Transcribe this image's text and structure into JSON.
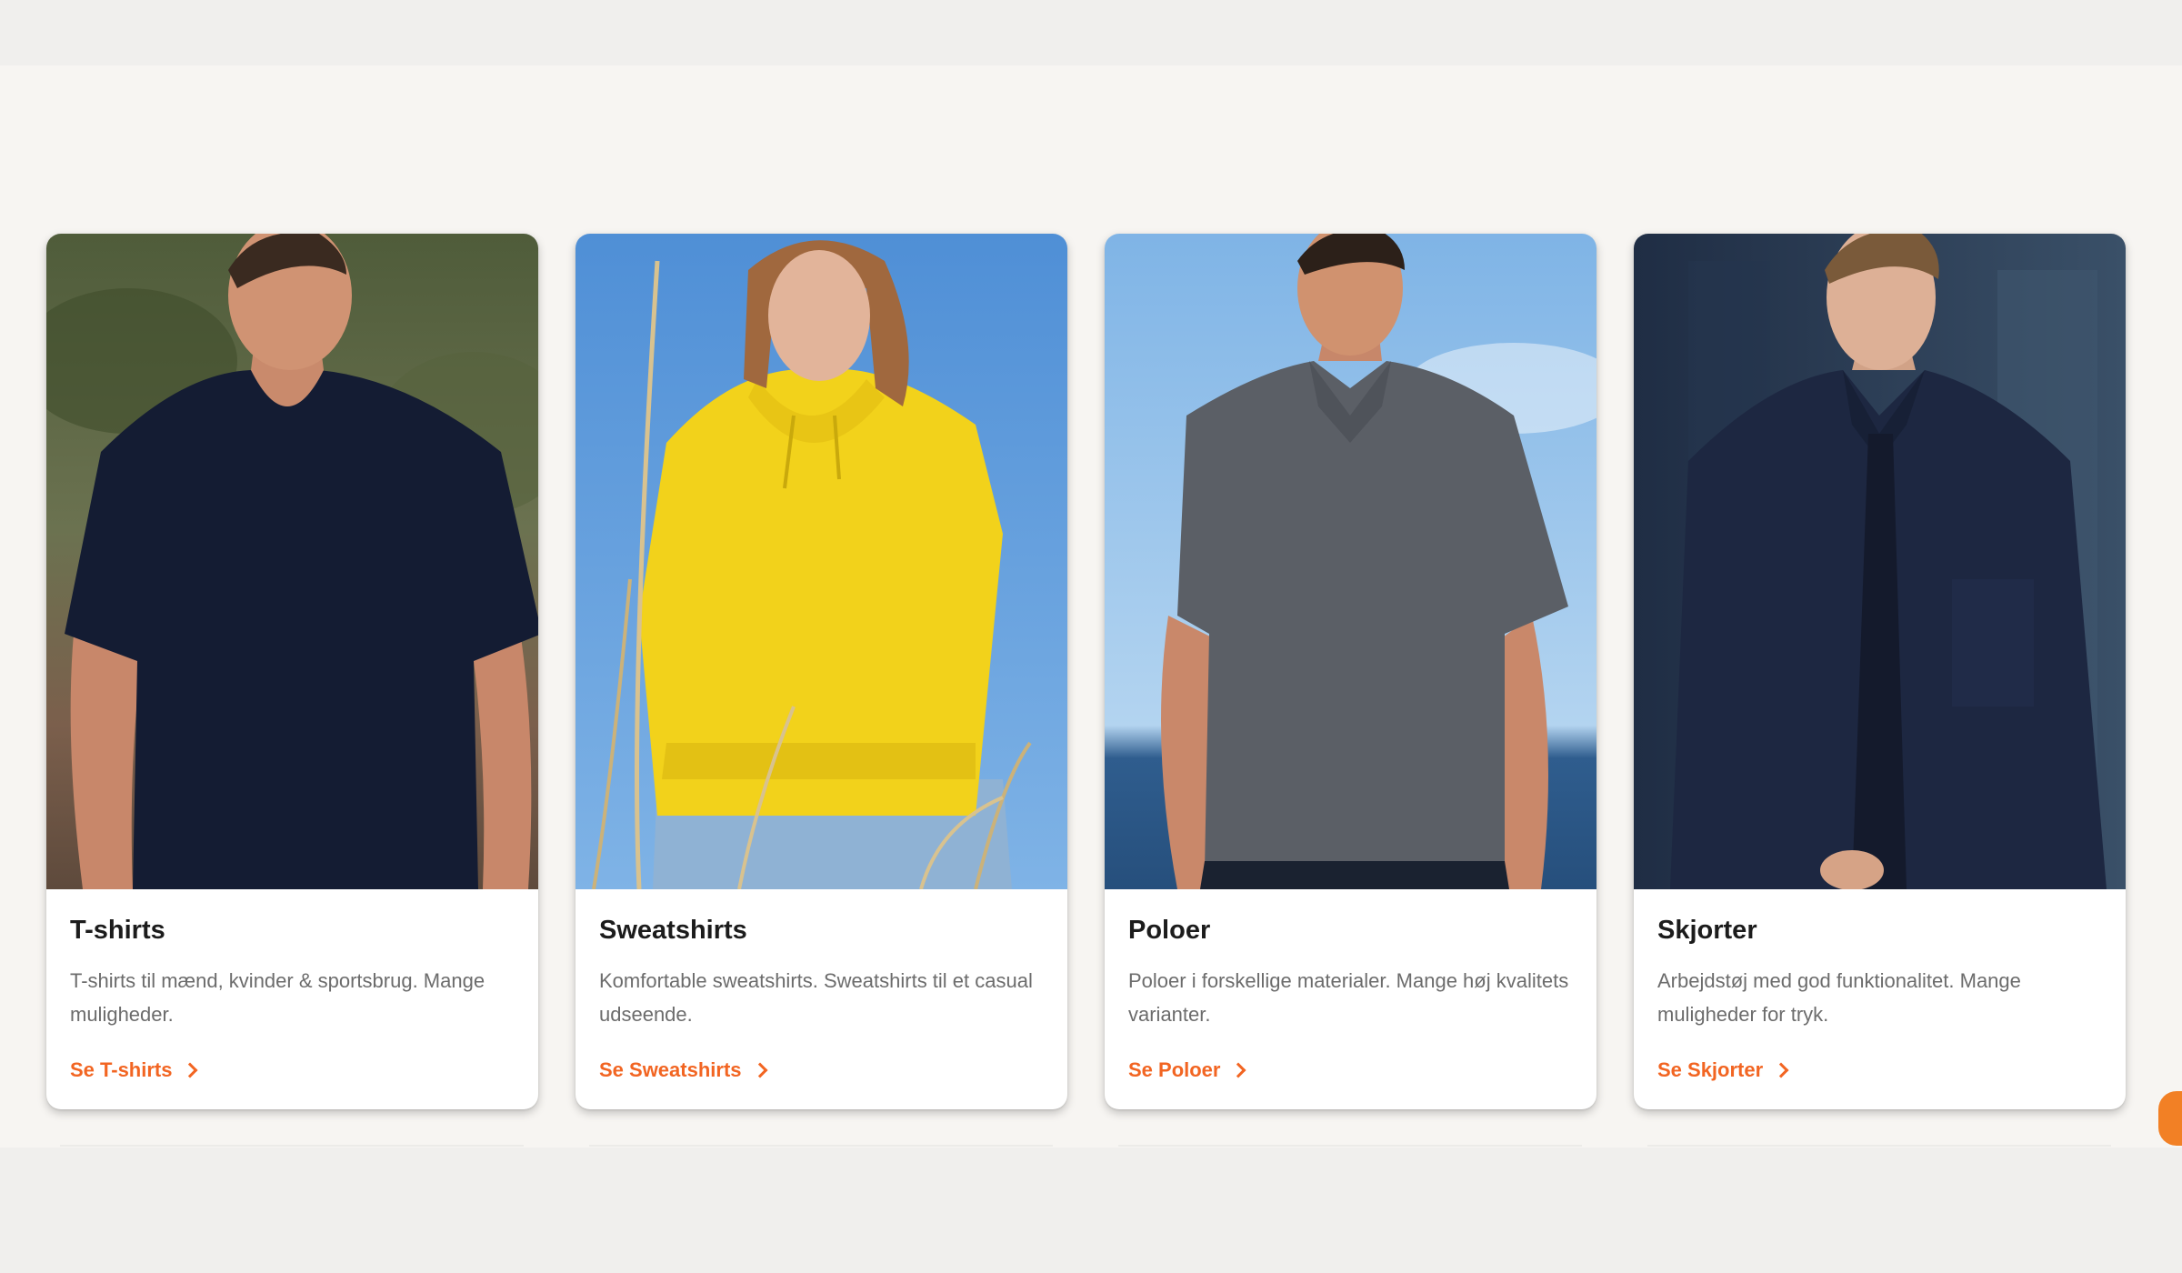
{
  "cards": [
    {
      "title": "T-shirts",
      "description": "T-shirts til mænd, kvinder & sportsbrug. Mange muligheder.",
      "link": "Se T-shirts"
    },
    {
      "title": "Sweatshirts",
      "description": "Komfortable sweatshirts. Sweatshirts til et casual udseende.",
      "link": "Se Sweatshirts"
    },
    {
      "title": "Poloer",
      "description": "Poloer i forskellige materialer. Mange høj kvalitets varianter.",
      "link": "Se Poloer"
    },
    {
      "title": "Skjorter",
      "description": "Arbejdstøj med god funktionalitet. Mange muligheder for tryk.",
      "link": "Se Skjorter"
    }
  ],
  "colors": {
    "accent": "#f26522",
    "background": "#f7f5f2",
    "card": "#ffffff"
  },
  "icons": {
    "link_arrow": "chevron-right-icon",
    "chat": "chat-bubble-icon"
  }
}
